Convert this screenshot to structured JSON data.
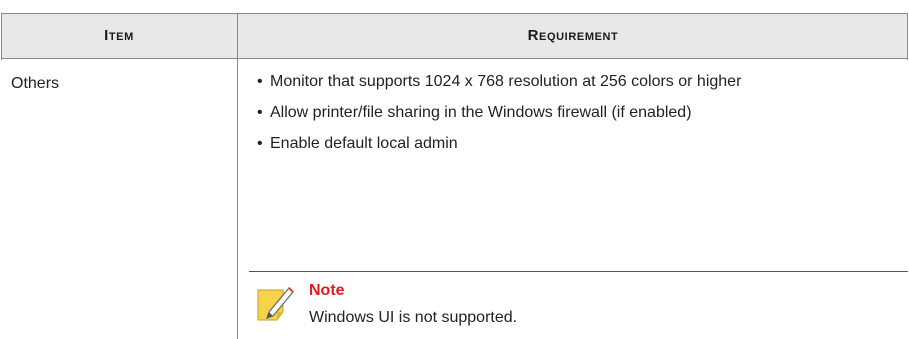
{
  "table": {
    "header": {
      "item": "Item",
      "requirement": "Requirement"
    },
    "rows": [
      {
        "item": "Others",
        "requirements": [
          "Monitor that supports 1024 x 768 resolution at 256 colors or higher",
          "Allow printer/file sharing in the Windows firewall (if enabled)",
          "Enable default local admin"
        ],
        "note": {
          "label": "Note",
          "text": "Windows UI is not supported.",
          "icon": "note-pencil-icon"
        }
      }
    ]
  },
  "colors": {
    "header_bg": "#e8e8e8",
    "note_label": "#e21b1b",
    "note_icon": "#f6d34a"
  }
}
